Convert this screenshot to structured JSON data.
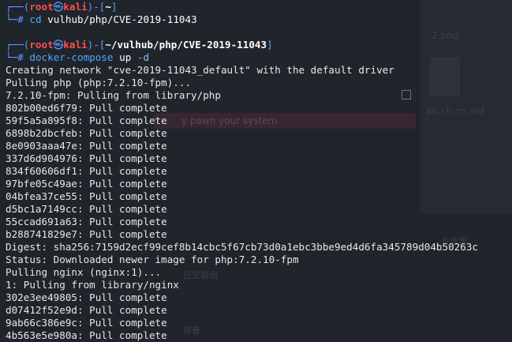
{
  "background_hints": {
    "file_label_1": "2.png",
    "file_label_2": "md",
    "file_label_3": "ab.ch.cn.md",
    "banner_text": "y pawn your system",
    "side_text_1": "在此图",
    "side_text_2": "已安装面",
    "side_text_3": "接着"
  },
  "prompt1": {
    "frame_left": "┌──(",
    "user": "root",
    "skull": "㉿",
    "host": "kali",
    "frame_mid": ")-[",
    "path": "~",
    "frame_right": "]",
    "frame_bottom": "└─",
    "hash": "#",
    "command": "cd",
    "arg": "vulhub/php/CVE-2019-11043"
  },
  "prompt2": {
    "frame_left": "┌──(",
    "user": "root",
    "skull": "㉿",
    "host": "kali",
    "frame_mid": ")-[",
    "path": "~/vulhub/php/CVE-2019-11043",
    "frame_right": "]",
    "frame_bottom": "└─",
    "hash": "#",
    "command": "docker-compose",
    "arg": "up",
    "flag": "-d"
  },
  "output": [
    "Creating network \"cve-2019-11043_default\" with the default driver",
    "Pulling php (php:7.2.10-fpm)...",
    "7.2.10-fpm: Pulling from library/php",
    "802b00ed6f79: Pull complete",
    "59f5a5a895f8: Pull complete",
    "6898b2dbcfeb: Pull complete",
    "8e0903aaa47e: Pull complete",
    "337d6d904976: Pull complete",
    "834f60606df1: Pull complete",
    "97bfe05c49ae: Pull complete",
    "04bfea37ce55: Pull complete",
    "d5bc1a7149cc: Pull complete",
    "55ccad691a63: Pull complete",
    "b288741829e7: Pull complete",
    "Digest: sha256:7159d2ecf99cef8b14cbc5f67cb73d0a1ebc3bbe9ed4d6fa345789d04b50263c",
    "Status: Downloaded newer image for php:7.2.10-fpm",
    "Pulling nginx (nginx:1)...",
    "1: Pulling from library/nginx",
    "302e3ee49805: Pull complete",
    "d07412f52e9d: Pull complete",
    "9ab66c386e9c: Pull complete",
    "4b563e5e980a: Pull complete"
  ]
}
